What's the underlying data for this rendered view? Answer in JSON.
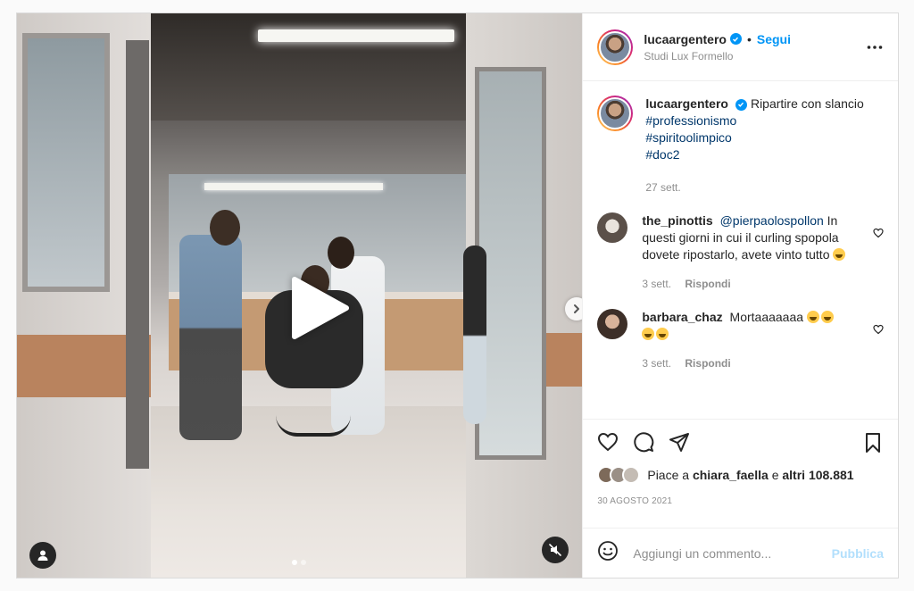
{
  "post": {
    "author": "lucaargentero",
    "follow_label": "Segui",
    "separator": "•",
    "location": "Studi Lux Formello",
    "caption": {
      "text": "Ripartire con slancio",
      "hashtags": [
        "#professionismo",
        "#spiritoolimpico",
        "#doc2"
      ],
      "time": "27 sett."
    },
    "comments": [
      {
        "user": "the_pinottis",
        "mention": "@pierpaolospollon",
        "text": "In questi giorni in cui il curling spopola dovete ripostarlo, avete vinto tutto",
        "time": "3 sett.",
        "reply_label": "Rispondi"
      },
      {
        "user": "barbara_chaz",
        "text": "Mortaaaaaaa",
        "time": "3 sett.",
        "reply_label": "Rispondi"
      }
    ],
    "likes": {
      "prefix": "Piace a",
      "user": "chiara_faella",
      "connector": "e",
      "others": "altri 108.881"
    },
    "date": "30 AGOSTO 2021",
    "comment_input_placeholder": "Aggiungi un commento...",
    "publish_label": "Pubblica"
  },
  "media": {
    "carousel_total": 2,
    "carousel_active": 1
  },
  "icons": {
    "play": "play-icon",
    "next": "chevron-right-icon",
    "user_tag": "user-icon",
    "mute": "speaker-muted-icon",
    "more": "more-horizontal-icon",
    "like": "heart-icon",
    "comment": "comment-bubble-icon",
    "share": "paper-plane-icon",
    "save": "bookmark-icon",
    "emoji": "smiley-icon"
  },
  "colors": {
    "accent": "#0095f6",
    "hashtag": "#00376b",
    "muted_text": "#8e8e8e",
    "publish_disabled": "#b2dffc"
  }
}
